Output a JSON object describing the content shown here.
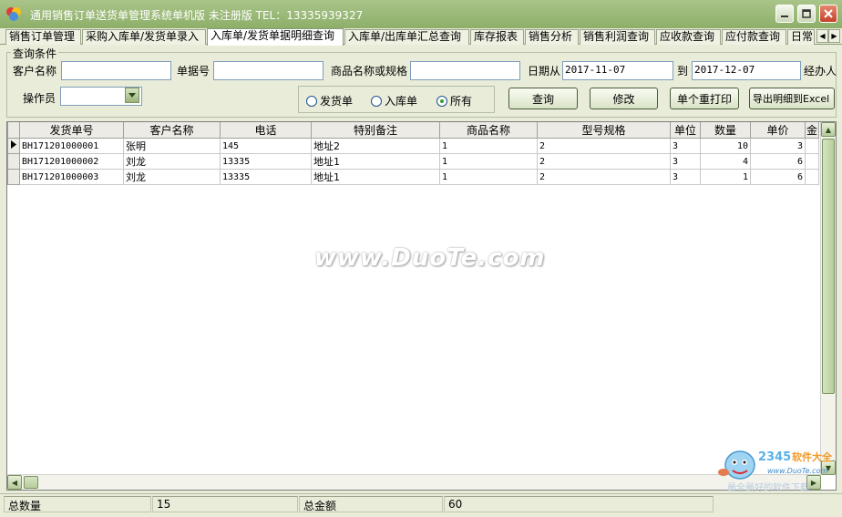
{
  "window": {
    "title": "通用销售订单送货单管理系统单机版   未注册版   TEL：13335939327"
  },
  "tabs": [
    {
      "label": "销售订单管理"
    },
    {
      "label": "采购入库单/发货单录入"
    },
    {
      "label": "入库单/发货单据明细查询"
    },
    {
      "label": "入库单/出库单汇总查询"
    },
    {
      "label": "库存报表"
    },
    {
      "label": "销售分析"
    },
    {
      "label": "销售利润查询"
    },
    {
      "label": "应收款查询"
    },
    {
      "label": "应付款查询"
    },
    {
      "label": "日常"
    }
  ],
  "query": {
    "group_label": "查询条件",
    "customer_label": "客户名称",
    "customer_value": "",
    "doc_no_label": "单据号",
    "doc_no_value": "",
    "product_label": "商品名称或规格",
    "product_value": "",
    "date_from_label": "日期从",
    "date_from": "2017-11-07",
    "date_to_label": "到",
    "date_to": "2017-12-07",
    "handler_label": "经办人",
    "operator_label": "操作员",
    "operator_value": "",
    "radio": {
      "ship": "发货单",
      "inbound": "入库单",
      "all": "所有",
      "selected": "all"
    },
    "buttons": {
      "query": "查询",
      "edit": "修改",
      "reprint": "单个重打印",
      "export": "导出明细到Excel"
    }
  },
  "grid": {
    "columns": [
      "发货单号",
      "客户名称",
      "电话",
      "特别备注",
      "商品名称",
      "型号规格",
      "单位",
      "数量",
      "单价",
      "金"
    ],
    "rows": [
      [
        "BH171201000001",
        "张明",
        "145",
        "地址2",
        "1",
        "2",
        "3",
        "10",
        "3"
      ],
      [
        "BH171201000002",
        "刘龙",
        "13335",
        "地址1",
        "1",
        "2",
        "3",
        "4",
        "6"
      ],
      [
        "BH171201000003",
        "刘龙",
        "13335",
        "地址1",
        "1",
        "2",
        "3",
        "1",
        "6"
      ]
    ]
  },
  "status": {
    "total_qty_label": "总数量",
    "total_qty": "15",
    "total_amount_label": "总金额",
    "total_amount": "60"
  },
  "watermark": {
    "text": "www.DuoTe.com",
    "logo_number": "2345",
    "logo_text": "软件大全",
    "logo_url": "www.DuoTe.com",
    "logo_sub": "最全最好的软件下载"
  },
  "colors": {
    "titlebar": "#97b875",
    "window_bg": "#e9ecd9",
    "close_button": "#c9553b"
  }
}
